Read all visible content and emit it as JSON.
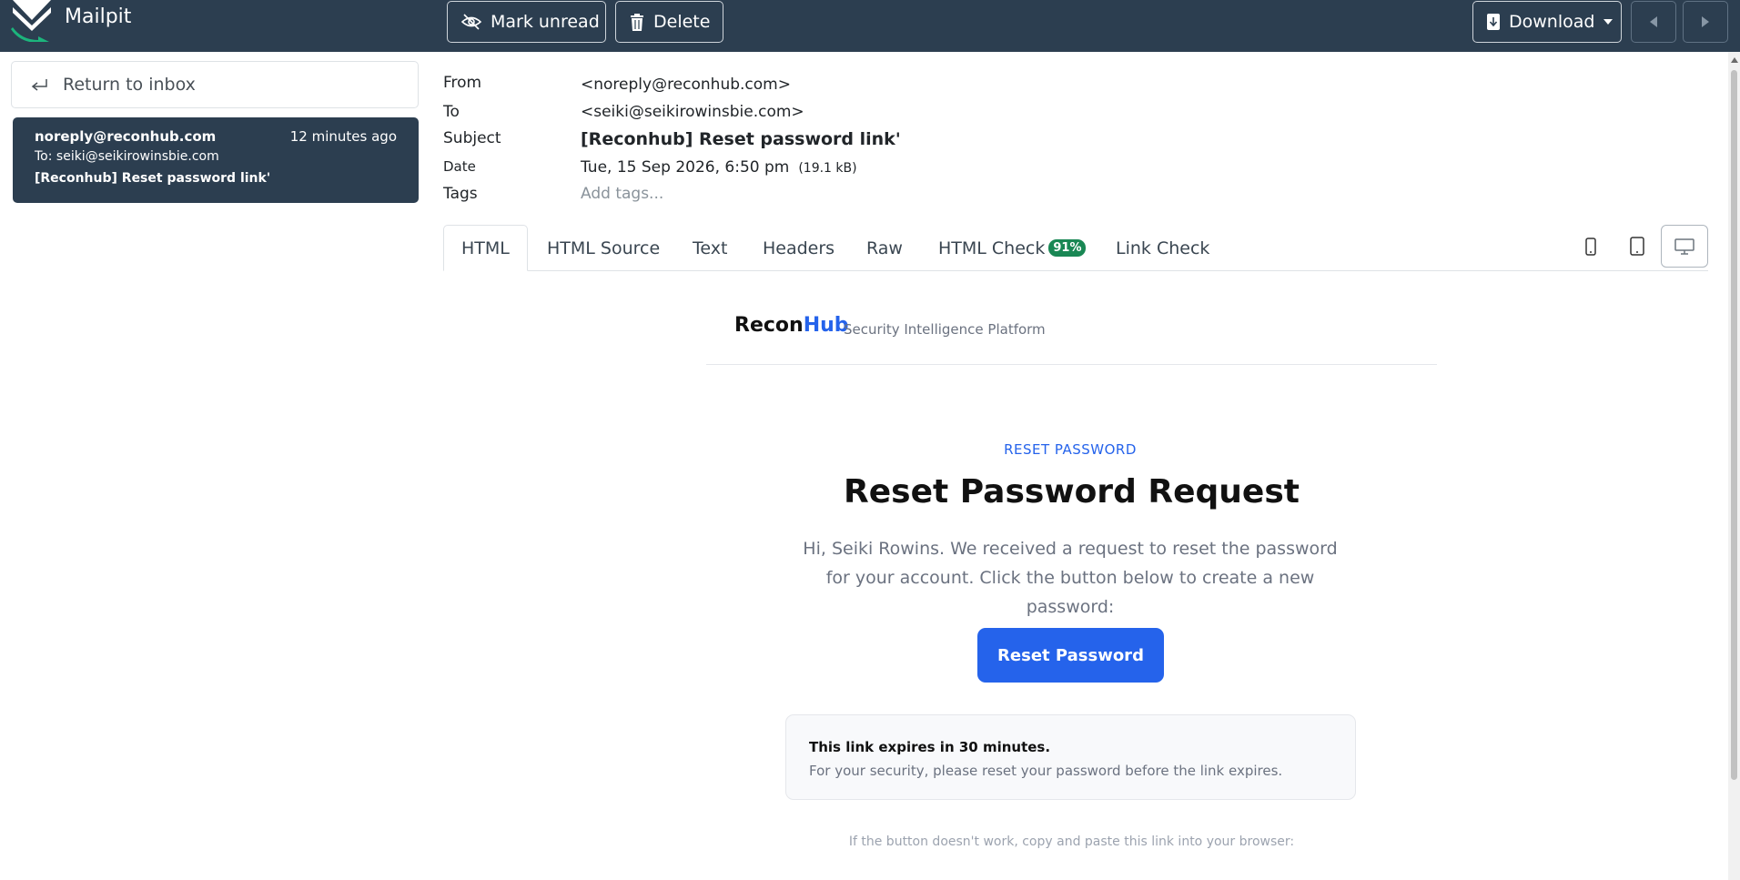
{
  "app": {
    "name": "Mailpit"
  },
  "toolbar": {
    "mark_unread": "Mark unread",
    "delete": "Delete",
    "download": "Download"
  },
  "sidebar": {
    "return_label": "Return to inbox",
    "message": {
      "from": "noreply@reconhub.com",
      "time": "12 minutes ago",
      "to": "To: seiki@seikirowinsbie.com",
      "subject": "[Reconhub] Reset password link'"
    }
  },
  "headers": {
    "from_label": "From",
    "from_value": "<noreply@reconhub.com>",
    "to_label": "To",
    "to_value": "<seiki@seikirowinsbie.com>",
    "subject_label": "Subject",
    "subject_value": "[Reconhub] Reset password link'",
    "date_label": "Date",
    "date_value": "Tue, 15 Sep 2026, 6:50 pm",
    "size": "(19.1 kB)",
    "tags_label": "Tags",
    "tags_placeholder": "Add tags..."
  },
  "tabs": {
    "html": "HTML",
    "html_source": "HTML Source",
    "text": "Text",
    "headers": "Headers",
    "raw": "Raw",
    "html_check": "HTML Check",
    "html_check_badge": "91%",
    "link_check": "Link Check",
    "active": "HTML",
    "view_modes": [
      "phone-icon",
      "tablet-icon",
      "desktop-icon"
    ],
    "active_view": "desktop"
  },
  "email": {
    "brand_recon": "Recon",
    "brand_hub": "Hub",
    "brand_tagline": "Security Intelligence Platform",
    "eyebrow": "RESET PASSWORD",
    "headline": "Reset Password Request",
    "body": "Hi, Seiki Rowins. We received a request to reset the password for your account. Click the button below to create a new password:",
    "button": "Reset Password",
    "notice_title": "This link expires in 30 minutes.",
    "notice_text": "For your security, please reset your password before the link expires.",
    "fallback": "If the button doesn't work, copy and paste this link into your browser:"
  },
  "colors": {
    "topbar": "#2c3e50",
    "accent_blue": "#2563eb",
    "badge_green": "#198754"
  }
}
